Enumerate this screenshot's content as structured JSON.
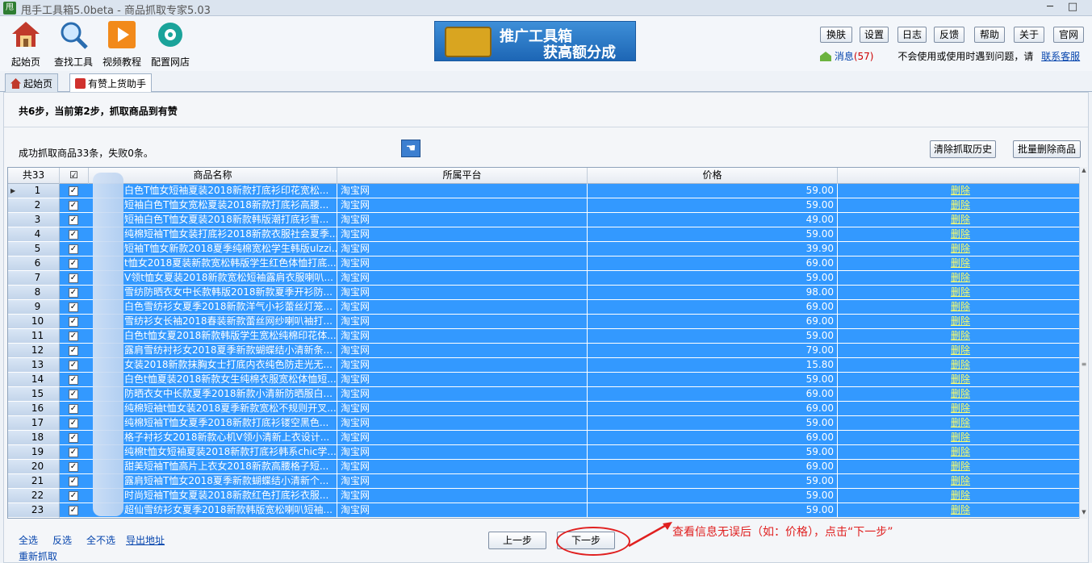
{
  "window": {
    "title": "甩手工具箱5.0beta - 商品抓取专家5.03",
    "app_icon_text": "甩",
    "controls": [
      "─",
      "□"
    ]
  },
  "toolbar": {
    "tools": [
      {
        "label": "起始页",
        "icon": "home-icon"
      },
      {
        "label": "查找工具",
        "icon": "magnifier-icon"
      },
      {
        "label": "视频教程",
        "icon": "play-icon"
      },
      {
        "label": "配置网店",
        "icon": "gear-icon"
      }
    ],
    "banner": {
      "line1": "推广工具箱",
      "line2": "获高额分成",
      "icon": "treasure-chest-icon"
    },
    "buttons": [
      "换肤",
      "设置",
      "日志",
      "反馈",
      "帮助",
      "关于",
      "官网"
    ],
    "message_label": "消息",
    "message_count": "(57)",
    "help_text": "不会使用或使用时遇到问题，请",
    "contact_link": "联系客服"
  },
  "tabs": [
    {
      "label": "起始页",
      "icon": "home-icon",
      "active": false
    },
    {
      "label": "有赞上货助手",
      "icon": "thumbs-up-icon",
      "active": true
    }
  ],
  "main": {
    "step_text": "共6步，当前第2步，抓取商品到有赞",
    "result_text": "成功抓取商品33条，失败0条。",
    "clear_history_button": "清除抓取历史",
    "batch_delete_button": "批量删除商品"
  },
  "grid": {
    "headers": {
      "count": "共33",
      "checkbox": "☑",
      "name": "商品名称",
      "platform": "所属平台",
      "price": "价格"
    },
    "rows": [
      {
        "n": "1",
        "name": "白色T恤女短袖夏装2018新款打底衫印花宽松...",
        "platform": "淘宝网",
        "price": "59.00",
        "action": "删除"
      },
      {
        "n": "2",
        "name": "短袖白色T恤女宽松夏装2018新款打底衫高腰...",
        "platform": "淘宝网",
        "price": "59.00",
        "action": "删除"
      },
      {
        "n": "3",
        "name": "短袖白色T恤女夏装2018新款韩版潮打底衫雪...",
        "platform": "淘宝网",
        "price": "49.00",
        "action": "删除"
      },
      {
        "n": "4",
        "name": "纯棉短袖T恤女装打底衫2018新款衣服社会夏季...",
        "platform": "淘宝网",
        "price": "59.00",
        "action": "删除"
      },
      {
        "n": "5",
        "name": "短袖T恤女新款2018夏季纯棉宽松学生韩版ulzzi...",
        "platform": "淘宝网",
        "price": "39.90",
        "action": "删除"
      },
      {
        "n": "6",
        "name": "t恤女2018夏装新款宽松韩版学生红色体恤打底...",
        "platform": "淘宝网",
        "price": "69.00",
        "action": "删除"
      },
      {
        "n": "7",
        "name": "V领t恤女夏装2018新款宽松短袖露肩衣服喇叭...",
        "platform": "淘宝网",
        "price": "59.00",
        "action": "删除"
      },
      {
        "n": "8",
        "name": "雪纺防晒衣女中长款韩版2018新款夏季开衫防...",
        "platform": "淘宝网",
        "price": "98.00",
        "action": "删除"
      },
      {
        "n": "9",
        "name": "白色雪纺衫女夏季2018新款洋气小衫蕾丝灯笼...",
        "platform": "淘宝网",
        "price": "69.00",
        "action": "删除"
      },
      {
        "n": "10",
        "name": "雪纺衫女长袖2018春装新款蕾丝网纱喇叭袖打...",
        "platform": "淘宝网",
        "price": "69.00",
        "action": "删除"
      },
      {
        "n": "11",
        "name": "白色t恤女夏2018新款韩版学生宽松纯棉印花体...",
        "platform": "淘宝网",
        "price": "59.00",
        "action": "删除"
      },
      {
        "n": "12",
        "name": "露肩雪纺衬衫女2018夏季新款蝴蝶结小清新条...",
        "platform": "淘宝网",
        "price": "79.00",
        "action": "删除"
      },
      {
        "n": "13",
        "name": "女装2018新款抹胸女士打底内衣纯色防走光无...",
        "platform": "淘宝网",
        "price": "15.80",
        "action": "删除"
      },
      {
        "n": "14",
        "name": "白色t恤夏装2018新款女生纯棉衣服宽松体恤短...",
        "platform": "淘宝网",
        "price": "59.00",
        "action": "删除"
      },
      {
        "n": "15",
        "name": "防晒衣女中长款夏季2018新款小清新防晒服白...",
        "platform": "淘宝网",
        "price": "69.00",
        "action": "删除"
      },
      {
        "n": "16",
        "name": "纯棉短袖t恤女装2018夏季新款宽松不规则开叉...",
        "platform": "淘宝网",
        "price": "69.00",
        "action": "删除"
      },
      {
        "n": "17",
        "name": "纯棉短袖T恤女夏季2018新款打底衫镂空黑色...",
        "platform": "淘宝网",
        "price": "59.00",
        "action": "删除"
      },
      {
        "n": "18",
        "name": "格子衬衫女2018新款心机V领小清新上衣设计...",
        "platform": "淘宝网",
        "price": "69.00",
        "action": "删除"
      },
      {
        "n": "19",
        "name": "纯棉t恤女短袖夏装2018新款打底衫韩系chic学...",
        "platform": "淘宝网",
        "price": "59.00",
        "action": "删除"
      },
      {
        "n": "20",
        "name": "甜美短袖T恤高片上衣女2018新款高腰格子短...",
        "platform": "淘宝网",
        "price": "69.00",
        "action": "删除"
      },
      {
        "n": "21",
        "name": "露肩短袖T恤女2018夏季新款蝴蝶结小清新个...",
        "platform": "淘宝网",
        "price": "59.00",
        "action": "删除"
      },
      {
        "n": "22",
        "name": "时尚短袖T恤女夏装2018新款红色打底衫衣服...",
        "platform": "淘宝网",
        "price": "59.00",
        "action": "删除"
      },
      {
        "n": "23",
        "name": "超仙雪纺衫女夏季2018新款韩版宽松喇叭短袖...",
        "platform": "淘宝网",
        "price": "59.00",
        "action": "删除"
      }
    ]
  },
  "bottom": {
    "select_all": "全选",
    "invert": "反选",
    "select_none": "全不选",
    "export": "导出地址",
    "refetch": "重新抓取",
    "prev": "上一步",
    "next": "下一步",
    "annotation": "查看信息无误后（如：价格），点击“下一步”"
  },
  "colors": {
    "selection": "#3399ff",
    "annotation": "#e02020",
    "link": "#0645ad"
  }
}
